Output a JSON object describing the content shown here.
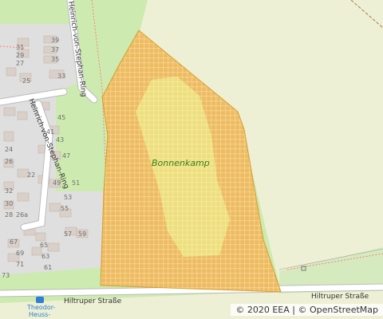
{
  "area": {
    "label": "Bonnenkamp"
  },
  "streets": {
    "ring_upper": "Heinrich-von-Stephan-Ring",
    "ring_lower": "Heinrich-von-Stephan-Ring",
    "main_left": "Hiltruper Straße",
    "main_right": "Hiltruper Straße"
  },
  "bus_stop": {
    "line1": "Theodor-",
    "line2": "Heuss-"
  },
  "house_numbers": [
    "39",
    "37",
    "35",
    "31",
    "29",
    "27",
    "33",
    "25",
    "45",
    "41",
    "43",
    "47",
    "22",
    "24",
    "26",
    "49",
    "51",
    "28",
    "32",
    "30",
    "53",
    "55",
    "26a",
    "57",
    "59",
    "67",
    "65",
    "69",
    "63",
    "71",
    "61",
    "73"
  ],
  "attribution": {
    "copyright": "© 2020 EEA",
    "separator": " | ",
    "osm": "© OpenStreetMap"
  },
  "colors": {
    "residential": "#e0dfdf",
    "green": "#cdebb0",
    "farmland": "#eef0d5",
    "meadow": "#d5ebbf",
    "building": "#d9d0c9",
    "overlay": "#e8b23a",
    "inner": "#ede47a",
    "road": "#ffffff"
  }
}
